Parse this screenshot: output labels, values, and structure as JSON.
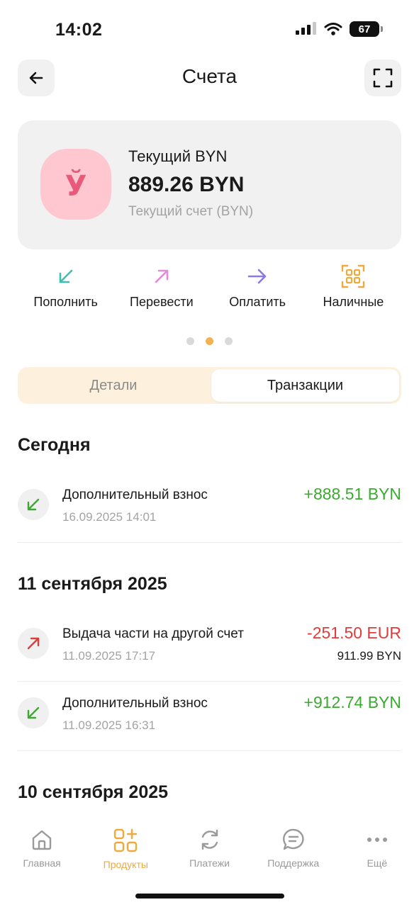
{
  "status_bar": {
    "time": "14:02",
    "battery": "67"
  },
  "header": {
    "title": "Счета"
  },
  "account": {
    "name": "Текущий BYN",
    "balance": "889.26 BYN",
    "subtitle": "Текущий счет (BYN)",
    "icon_glyph": "Ў",
    "icon_color": "#e8597a",
    "icon_bg": "#ffc8d0"
  },
  "actions": [
    {
      "label": "Пополнить",
      "icon": "arrow-down-left-icon",
      "color": "#3fbfb0"
    },
    {
      "label": "Перевести",
      "icon": "arrow-up-right-icon",
      "color": "#e58ad6"
    },
    {
      "label": "Оплатить",
      "icon": "arrow-right-icon",
      "color": "#8b79e8"
    },
    {
      "label": "Наличные",
      "icon": "qr-code-icon",
      "color": "#f0a93b"
    }
  ],
  "pager": {
    "count": 3,
    "active_index": 1
  },
  "tabs": {
    "details": "Детали",
    "transactions": "Транзакции",
    "active": "transactions"
  },
  "sections": [
    {
      "title": "Сегодня",
      "transactions": [
        {
          "title": "Дополнительный взнос",
          "date": "16.09.2025 14:01",
          "amount": "+888.51 BYN",
          "direction": "in"
        }
      ]
    },
    {
      "title": "11 сентября 2025",
      "transactions": [
        {
          "title": "Выдача части на другой счет",
          "date": "11.09.2025 17:17",
          "amount": "-251.50 EUR",
          "secondary": "911.99 BYN",
          "direction": "out"
        },
        {
          "title": "Дополнительный взнос",
          "date": "11.09.2025 16:31",
          "amount": "+912.74 BYN",
          "direction": "in"
        }
      ]
    },
    {
      "title": "10 сентября 2025",
      "transactions": []
    }
  ],
  "nav": [
    {
      "label": "Главная",
      "icon": "home-icon",
      "active": false
    },
    {
      "label": "Продукты",
      "icon": "products-grid-icon",
      "active": true
    },
    {
      "label": "Платежи",
      "icon": "refresh-icon",
      "active": false
    },
    {
      "label": "Поддержка",
      "icon": "chat-bubble-icon",
      "active": false
    },
    {
      "label": "Ещё",
      "icon": "more-dots-icon",
      "active": false
    }
  ],
  "colors": {
    "accent": "#f0a93b",
    "positive": "#3aab2f",
    "negative": "#e23b3b",
    "muted": "#a3a3a3"
  }
}
